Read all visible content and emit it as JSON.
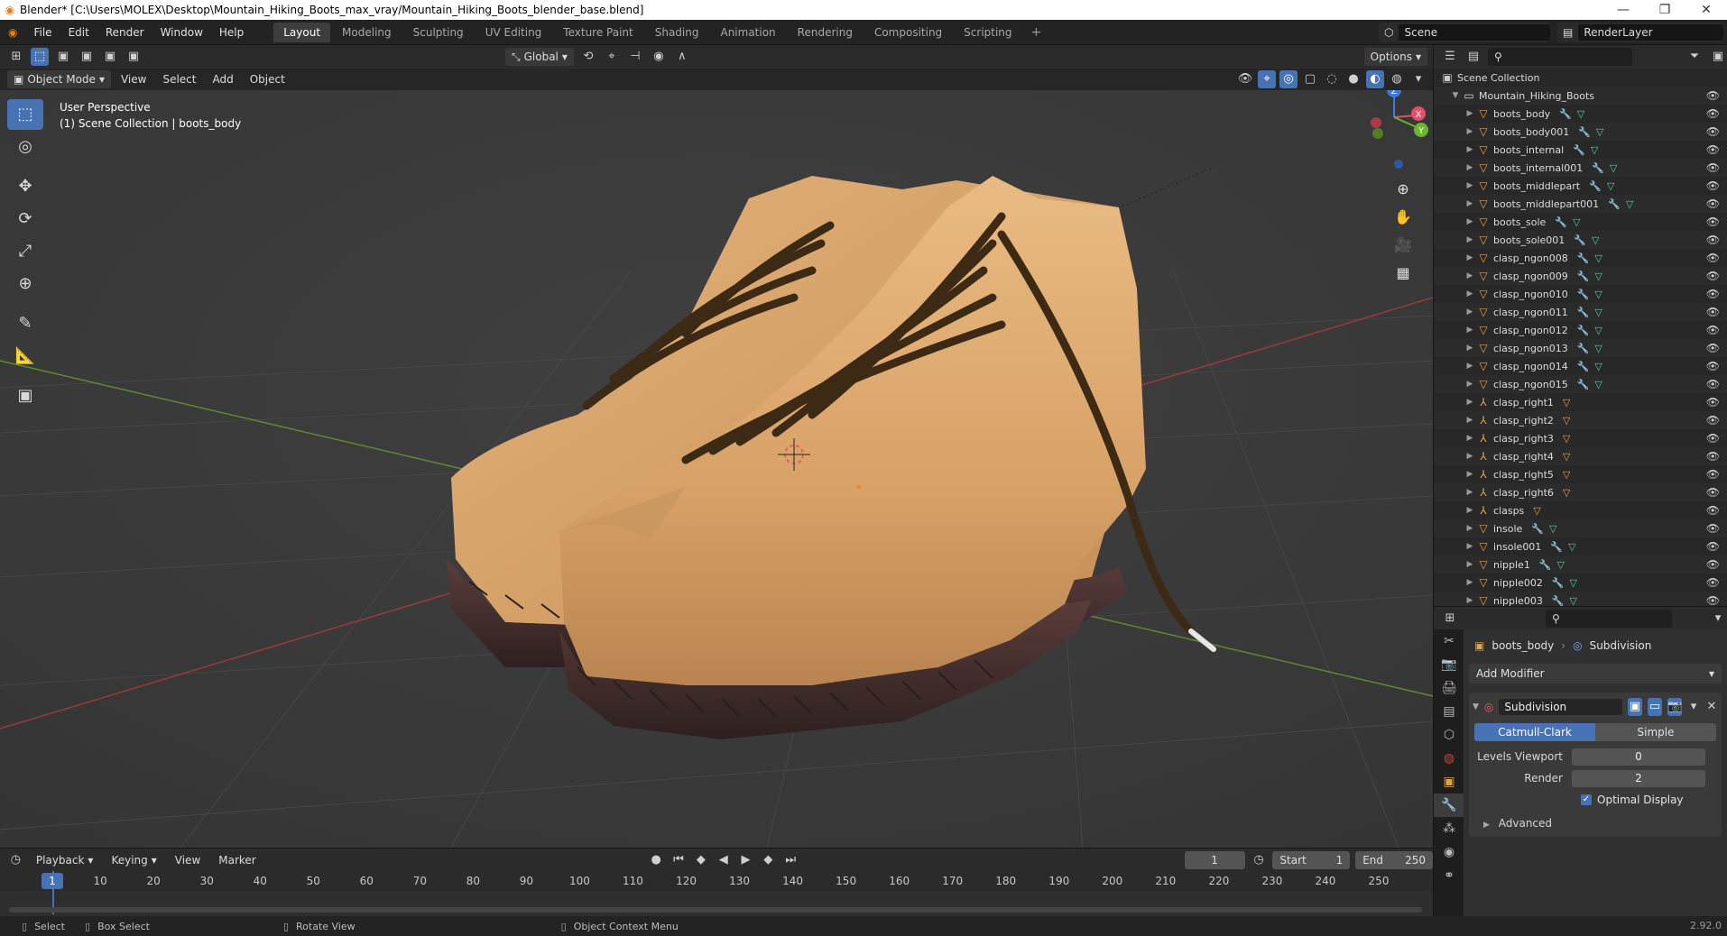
{
  "window": {
    "title": "Blender* [C:\\Users\\MOLEX\\Desktop\\Mountain_Hiking_Boots_max_vray/Mountain_Hiking_Boots_blender_base.blend]",
    "minimize": "—",
    "maximize": "❐",
    "close": "✕"
  },
  "menubar": {
    "items": [
      "File",
      "Edit",
      "Render",
      "Window",
      "Help"
    ],
    "workspaces": [
      "Layout",
      "Modeling",
      "Sculpting",
      "UV Editing",
      "Texture Paint",
      "Shading",
      "Animation",
      "Rendering",
      "Compositing",
      "Scripting"
    ],
    "active_workspace": "Layout",
    "add_tab": "+",
    "scene": "Scene",
    "render_layer": "RenderLayer"
  },
  "viewport_header": {
    "mode": "Object Mode",
    "menus": [
      "View",
      "Select",
      "Add",
      "Object"
    ],
    "transform_orientation": "Global",
    "options": "Options"
  },
  "viewport": {
    "perspective": "User Perspective",
    "collection_info": "(1) Scene Collection | boots_body",
    "axes": {
      "x": "X",
      "y": "Y",
      "z": "Z"
    }
  },
  "toolbar": {
    "tools": [
      "select-box",
      "cursor",
      "move",
      "rotate",
      "scale",
      "transform",
      "annotate",
      "measure",
      "add-cube"
    ]
  },
  "outliner": {
    "root": "Scene Collection",
    "collection": "Mountain_Hiking_Boots",
    "items": [
      {
        "name": "boots_body",
        "type": "mesh"
      },
      {
        "name": "boots_body001",
        "type": "mesh"
      },
      {
        "name": "boots_internal",
        "type": "mesh"
      },
      {
        "name": "boots_internal001",
        "type": "mesh"
      },
      {
        "name": "boots_middlepart",
        "type": "mesh"
      },
      {
        "name": "boots_middlepart001",
        "type": "mesh"
      },
      {
        "name": "boots_sole",
        "type": "mesh"
      },
      {
        "name": "boots_sole001",
        "type": "mesh"
      },
      {
        "name": "clasp_ngon008",
        "type": "mesh"
      },
      {
        "name": "clasp_ngon009",
        "type": "mesh"
      },
      {
        "name": "clasp_ngon010",
        "type": "mesh"
      },
      {
        "name": "clasp_ngon011",
        "type": "mesh"
      },
      {
        "name": "clasp_ngon012",
        "type": "mesh"
      },
      {
        "name": "clasp_ngon013",
        "type": "mesh"
      },
      {
        "name": "clasp_ngon014",
        "type": "mesh"
      },
      {
        "name": "clasp_ngon015",
        "type": "mesh"
      },
      {
        "name": "clasp_right1",
        "type": "armature"
      },
      {
        "name": "clasp_right2",
        "type": "armature"
      },
      {
        "name": "clasp_right3",
        "type": "armature"
      },
      {
        "name": "clasp_right4",
        "type": "armature"
      },
      {
        "name": "clasp_right5",
        "type": "armature"
      },
      {
        "name": "clasp_right6",
        "type": "armature"
      },
      {
        "name": "clasps",
        "type": "armature"
      },
      {
        "name": "insole",
        "type": "mesh"
      },
      {
        "name": "insole001",
        "type": "mesh"
      },
      {
        "name": "nipple1",
        "type": "mesh"
      },
      {
        "name": "nipple002",
        "type": "mesh"
      },
      {
        "name": "nipple003",
        "type": "mesh"
      }
    ]
  },
  "properties": {
    "object": "boots_body",
    "modifier_tab": "Subdivision",
    "add_modifier": "Add Modifier",
    "modifier_name": "Subdivision",
    "algorithm_on": "Catmull-Clark",
    "algorithm_off": "Simple",
    "levels_viewport_label": "Levels Viewport",
    "levels_viewport": "0",
    "render_label": "Render",
    "render": "2",
    "optimal_display": "Optimal Display",
    "advanced": "Advanced"
  },
  "timeline": {
    "menus": [
      "Playback",
      "Keying",
      "View",
      "Marker"
    ],
    "current_frame": "1",
    "start_label": "Start",
    "start": "1",
    "end_label": "End",
    "end": "250",
    "ticks": [
      "10",
      "20",
      "30",
      "40",
      "50",
      "60",
      "70",
      "80",
      "90",
      "100",
      "110",
      "120",
      "130",
      "140",
      "150",
      "160",
      "170",
      "180",
      "190",
      "200",
      "210",
      "220",
      "230",
      "240",
      "250"
    ]
  },
  "statusbar": {
    "select": "Select",
    "box_select": "Box Select",
    "rotate_view": "Rotate View",
    "context_menu": "Object Context Menu",
    "version": "2.92.0"
  },
  "colors": {
    "accent": "#4772b3",
    "leather": "#d7a46b",
    "sole": "#4a3331",
    "lace": "#3d2a14"
  }
}
